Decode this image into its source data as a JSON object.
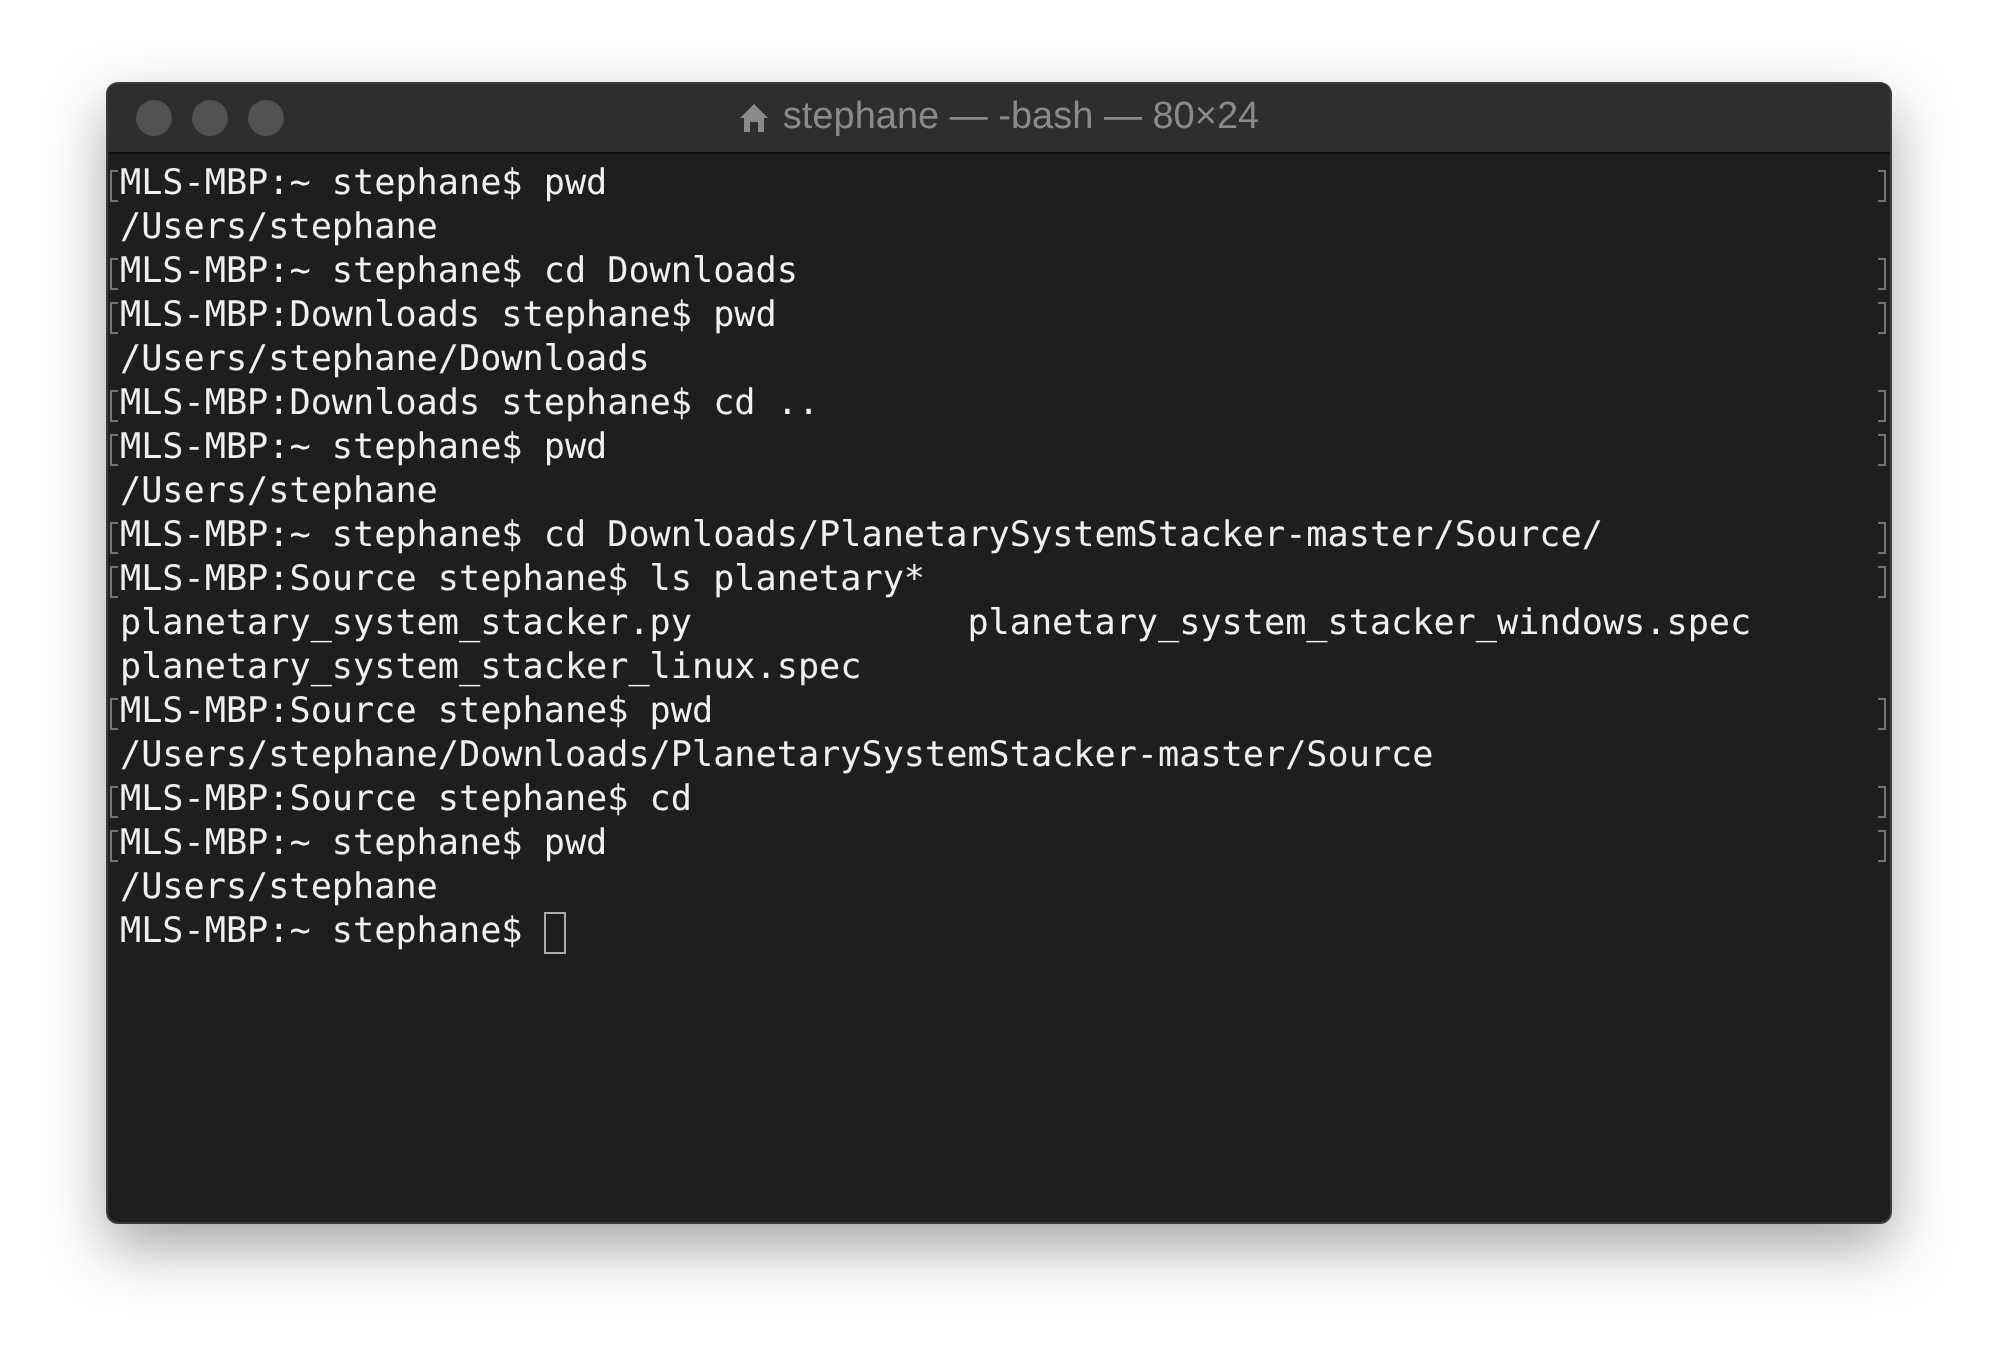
{
  "window": {
    "title": "stephane — -bash — 80×24"
  },
  "lines": [
    {
      "kind": "text",
      "text": "MLS-MBP:~ stephane$ pwd",
      "marked": true
    },
    {
      "kind": "text",
      "text": "/Users/stephane",
      "marked": false
    },
    {
      "kind": "text",
      "text": "MLS-MBP:~ stephane$ cd Downloads",
      "marked": true
    },
    {
      "kind": "text",
      "text": "MLS-MBP:Downloads stephane$ pwd",
      "marked": true
    },
    {
      "kind": "text",
      "text": "/Users/stephane/Downloads",
      "marked": false
    },
    {
      "kind": "text",
      "text": "MLS-MBP:Downloads stephane$ cd ..",
      "marked": true
    },
    {
      "kind": "text",
      "text": "MLS-MBP:~ stephane$ pwd",
      "marked": true
    },
    {
      "kind": "text",
      "text": "/Users/stephane",
      "marked": false
    },
    {
      "kind": "text",
      "text": "MLS-MBP:~ stephane$ cd Downloads/PlanetarySystemStacker-master/Source/",
      "marked": true
    },
    {
      "kind": "text",
      "text": "MLS-MBP:Source stephane$ ls planetary*",
      "marked": true
    },
    {
      "kind": "columns",
      "cells": [
        "planetary_system_stacker.py",
        "planetary_system_stacker_windows.spec"
      ],
      "marked": false
    },
    {
      "kind": "text",
      "text": "planetary_system_stacker_linux.spec",
      "marked": false
    },
    {
      "kind": "text",
      "text": "MLS-MBP:Source stephane$ pwd",
      "marked": true
    },
    {
      "kind": "text",
      "text": "/Users/stephane/Downloads/PlanetarySystemStacker-master/Source",
      "marked": false
    },
    {
      "kind": "text",
      "text": "MLS-MBP:Source stephane$ cd",
      "marked": true
    },
    {
      "kind": "text",
      "text": "MLS-MBP:~ stephane$ pwd",
      "marked": true
    },
    {
      "kind": "text",
      "text": "/Users/stephane",
      "marked": false
    },
    {
      "kind": "prompt",
      "text": "MLS-MBP:~ stephane$",
      "marked": false,
      "cursor": true
    }
  ]
}
